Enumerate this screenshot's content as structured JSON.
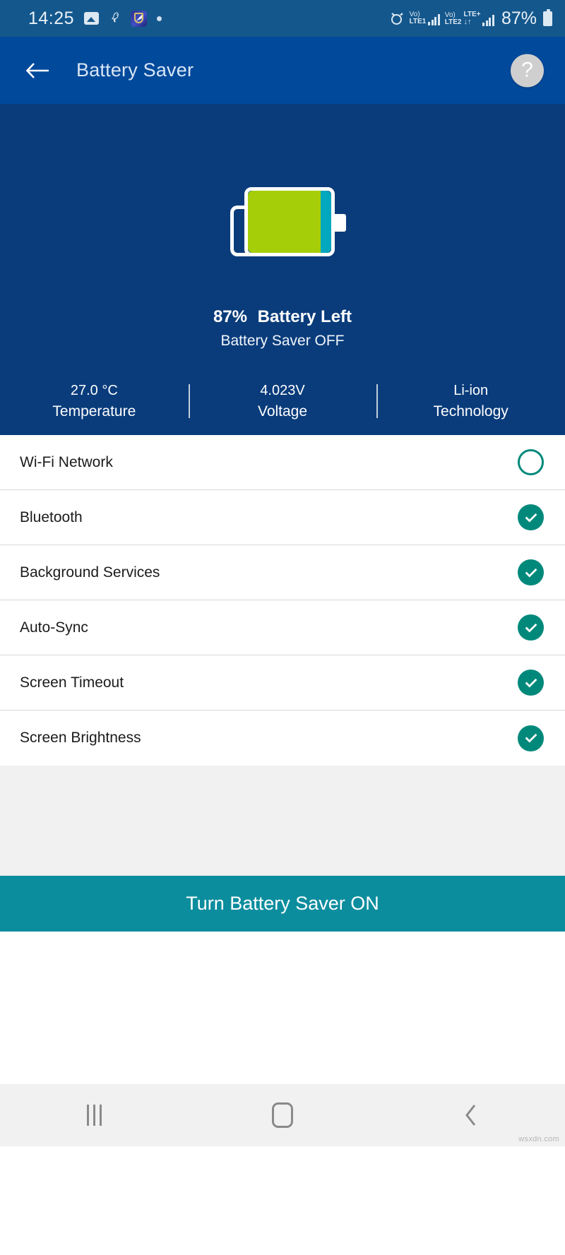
{
  "status_bar": {
    "clock": "14:25",
    "battery_percent": "87%",
    "icons": [
      "gallery-icon",
      "bird-icon",
      "shield-app-icon",
      "dot-icon",
      "alarm-icon",
      "battery-icon"
    ],
    "sim1": {
      "voice": "Vo)",
      "network": "LTE1"
    },
    "sim2": {
      "voice": "Vo)",
      "network": "LTE2",
      "data_type": "LTE+",
      "data_arrows": "↓↑"
    },
    "background_color": "#14578C"
  },
  "app_bar": {
    "title": "Battery Saver",
    "back_icon": "back-arrow-icon",
    "help_label": "?",
    "background_color": "#00499B"
  },
  "hero": {
    "background_color": "#0A3C7B",
    "battery_level_percent": 87,
    "battery_fill_color": "#A6CE08",
    "battery_empty_color": "#00A7BE",
    "percent_text": "87%",
    "percent_label": "Battery Left",
    "saver_status": "Battery Saver OFF",
    "stats": [
      {
        "value": "27.0 °C",
        "label": "Temperature"
      },
      {
        "value": "4.023V",
        "label": "Voltage"
      },
      {
        "value": "Li-ion",
        "label": "Technology"
      }
    ]
  },
  "settings_list": [
    {
      "label": "Wi-Fi Network",
      "checked": false
    },
    {
      "label": "Bluetooth",
      "checked": true
    },
    {
      "label": "Background Services",
      "checked": true
    },
    {
      "label": "Auto-Sync",
      "checked": true
    },
    {
      "label": "Screen Timeout",
      "checked": true
    },
    {
      "label": "Screen Brightness",
      "checked": true
    }
  ],
  "cta": {
    "label": "Turn Battery Saver ON",
    "background_color": "#0C8D9E"
  },
  "nav_bar": {
    "recents_icon": "recents-icon",
    "home_icon": "home-icon",
    "back_icon": "back-chevron-icon"
  },
  "watermark": "wsxdn.com",
  "accent_color": "#00897B"
}
